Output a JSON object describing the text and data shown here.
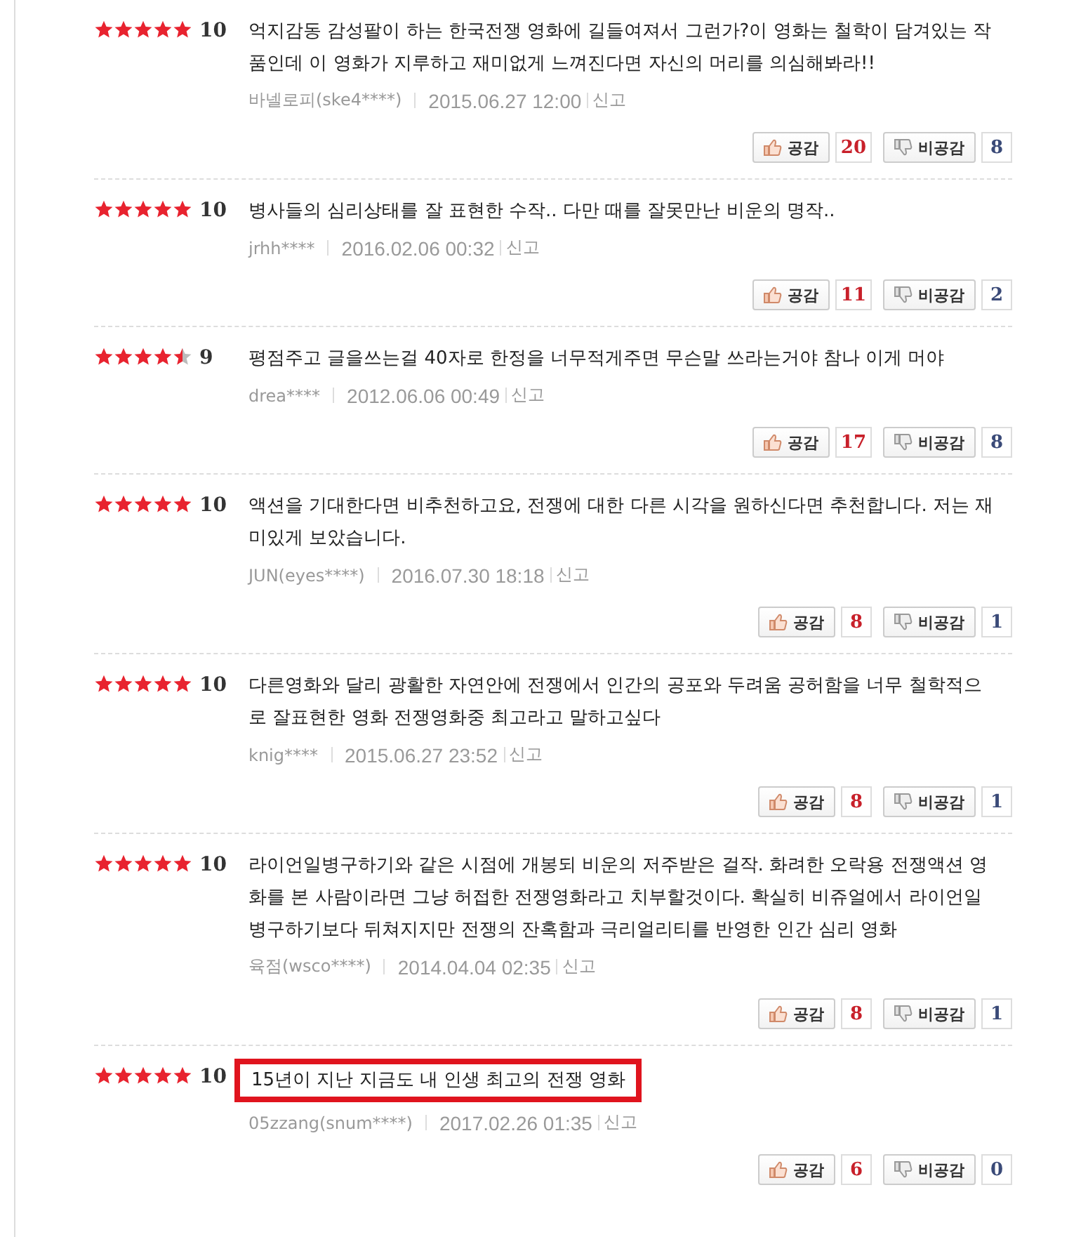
{
  "reviews": [
    {
      "stars": 5,
      "score": "10",
      "text": "억지감동 감성팔이 하는 한국전쟁 영화에 길들여져서 그런가?이 영화는 철학이 담겨있는 작품인데 이 영화가 지루하고 재미없게 느껴진다면 자신의 머리를 의심해봐라!!",
      "author": "바넬로피(ske4****)",
      "date": "2015.06.27 12:00",
      "report": "신고",
      "like_label": "공감",
      "likes": "20",
      "dislike_label": "비공감",
      "dislikes": "8",
      "highlighted": false
    },
    {
      "stars": 5,
      "score": "10",
      "text": "병사들의 심리상태를 잘 표현한 수작.. 다만 때를 잘못만난 비운의 명작..",
      "author": "jrhh****",
      "date": "2016.02.06 00:32",
      "report": "신고",
      "like_label": "공감",
      "likes": "11",
      "dislike_label": "비공감",
      "dislikes": "2",
      "highlighted": false
    },
    {
      "stars": 4.5,
      "score": "9",
      "text": "평점주고 글을쓰는걸 40자로 한정을 너무적게주면 무슨말 쓰라는거야 참나 이게 머야",
      "author": "drea****",
      "date": "2012.06.06 00:49",
      "report": "신고",
      "like_label": "공감",
      "likes": "17",
      "dislike_label": "비공감",
      "dislikes": "8",
      "highlighted": false
    },
    {
      "stars": 5,
      "score": "10",
      "text": "액션을 기대한다면 비추천하고요, 전쟁에 대한 다른 시각을 원하신다면 추천합니다. 저는 재미있게 보았습니다.",
      "author": "JUN(eyes****)",
      "date": "2016.07.30 18:18",
      "report": "신고",
      "like_label": "공감",
      "likes": "8",
      "dislike_label": "비공감",
      "dislikes": "1",
      "highlighted": false
    },
    {
      "stars": 5,
      "score": "10",
      "text": "다른영화와 달리 광활한 자연안에 전쟁에서 인간의 공포와 두려움 공허함을 너무 철학적으로 잘표현한 영화 전쟁영화중 최고라고 말하고싶다",
      "author": "knig****",
      "date": "2015.06.27 23:52",
      "report": "신고",
      "like_label": "공감",
      "likes": "8",
      "dislike_label": "비공감",
      "dislikes": "1",
      "highlighted": false
    },
    {
      "stars": 5,
      "score": "10",
      "text": "라이언일병구하기와 같은 시점에 개봉되 비운의 저주받은 걸작. 화려한 오락용 전쟁액션 영화를 본 사람이라면 그냥 허접한 전쟁영화라고 치부할것이다. 확실히 비쥬얼에서 라이언일병구하기보다 뒤쳐지지만 전쟁의 잔혹함과 극리얼리티를 반영한 인간 심리 영화",
      "author": "육점(wsco****)",
      "date": "2014.04.04 02:35",
      "report": "신고",
      "like_label": "공감",
      "likes": "8",
      "dislike_label": "비공감",
      "dislikes": "1",
      "highlighted": false
    },
    {
      "stars": 5,
      "score": "10",
      "text": "15년이 지난 지금도 내 인생 최고의 전쟁 영화",
      "author": "05zzang(snum****)",
      "date": "2017.02.26 01:35",
      "report": "신고",
      "like_label": "공감",
      "likes": "6",
      "dislike_label": "비공감",
      "dislikes": "0",
      "highlighted": true
    }
  ]
}
